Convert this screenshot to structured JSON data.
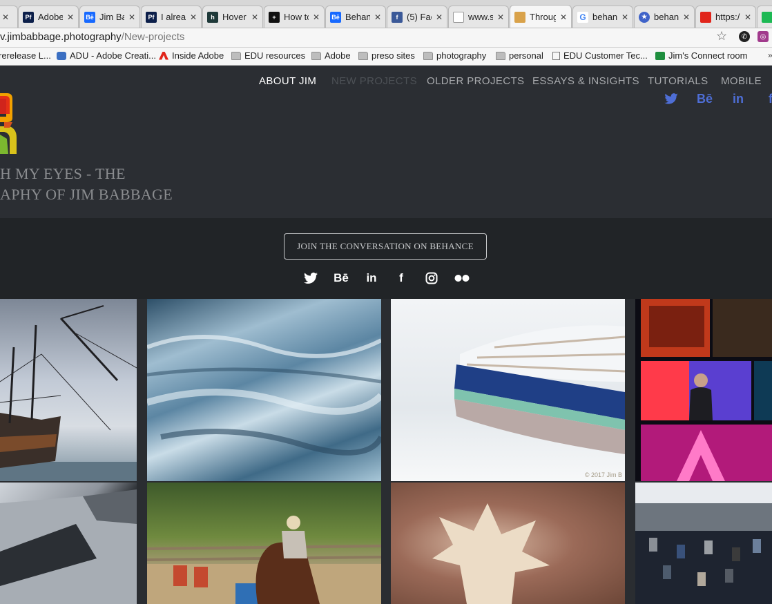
{
  "tabs": [
    {
      "label": "Adobe",
      "favicon": "Pf",
      "color": "#0c1f4a",
      "text_color": "#ffffff",
      "active": false
    },
    {
      "label": "Jim Ba",
      "favicon": "Bē",
      "color": "#1769ff",
      "text_color": "#ffffff",
      "active": false
    },
    {
      "label": "I alrea",
      "favicon": "Pf",
      "color": "#0c1f4a",
      "text_color": "#ffffff",
      "active": false
    },
    {
      "label": "Hover",
      "favicon": "h",
      "color": "#1f3a3a",
      "text_color": "#ffffff",
      "active": false
    },
    {
      "label": "How to",
      "favicon": "+",
      "color": "#111111",
      "text_color": "#ffffff",
      "active": false
    },
    {
      "label": "Behan",
      "favicon": "Bē",
      "color": "#1769ff",
      "text_color": "#ffffff",
      "active": false
    },
    {
      "label": "(5) Fac",
      "favicon": "f",
      "color": "#3b5998",
      "text_color": "#ffffff",
      "active": false
    },
    {
      "label": "www.s",
      "favicon": "",
      "color": "#ffffff",
      "text_color": "#333333",
      "active": false
    },
    {
      "label": "Throug",
      "favicon": "",
      "color": "#d9a24a",
      "text_color": "#ffffff",
      "active": true
    },
    {
      "label": "behanc",
      "favicon": "G",
      "color": "#ffffff",
      "text_color": "#4285f4",
      "active": false
    },
    {
      "label": "behanc",
      "favicon": "★",
      "color": "#3f63c9",
      "text_color": "#ffffff",
      "active": false
    },
    {
      "label": "https:/",
      "favicon": "",
      "color": "#e1251b",
      "text_color": "#ffffff",
      "active": false
    }
  ],
  "address_bar": {
    "host": "v.jimbabbage.photography",
    "path": "/New-projects"
  },
  "bookmarks": [
    {
      "label": "rerelease L...",
      "icon": "none"
    },
    {
      "label": "ADU - Adobe Creati...",
      "icon": "cube"
    },
    {
      "label": "Inside Adobe",
      "icon": "adobe"
    },
    {
      "label": "EDU resources",
      "icon": "folder"
    },
    {
      "label": "Adobe",
      "icon": "folder"
    },
    {
      "label": "preso sites",
      "icon": "folder"
    },
    {
      "label": "photography",
      "icon": "folder"
    },
    {
      "label": "personal",
      "icon": "folder"
    },
    {
      "label": "EDU Customer Tec...",
      "icon": "doc"
    },
    {
      "label": "Jim's Connect room",
      "icon": "gdoc"
    }
  ],
  "site": {
    "title_line1": "H MY EYES - THE",
    "title_line2": "APHY OF JIM BABBAGE",
    "nav": [
      {
        "label": "ABOUT JIM",
        "state": "active"
      },
      {
        "label": "NEW PROJECTS",
        "state": "current"
      },
      {
        "label": "OLDER PROJECTS",
        "state": "normal"
      },
      {
        "label": "ESSAYS & INSIGHTS",
        "state": "normal"
      },
      {
        "label": "TUTORIALS",
        "state": "normal"
      },
      {
        "label": "MOBILE",
        "state": "normal"
      }
    ],
    "header_social": [
      "twitter-icon",
      "behance-icon",
      "linkedin-icon",
      "facebook-icon"
    ],
    "cta_label": "JOIN THE CONVERSATION ON BEHANCE",
    "social_icons": [
      "twitter-icon",
      "behance-icon",
      "linkedin-icon",
      "facebook-icon",
      "instagram-icon",
      "flickr-icon"
    ],
    "watermark": "© 2017 Jim B",
    "accent_color": "#4e6ed6"
  },
  "gallery": [
    {
      "name": "tile-ship"
    },
    {
      "name": "tile-ice"
    },
    {
      "name": "tile-boat"
    },
    {
      "name": "tile-conference"
    },
    {
      "name": "tile-architecture"
    },
    {
      "name": "tile-rodeo"
    },
    {
      "name": "tile-leaf"
    },
    {
      "name": "tile-crowd"
    }
  ]
}
